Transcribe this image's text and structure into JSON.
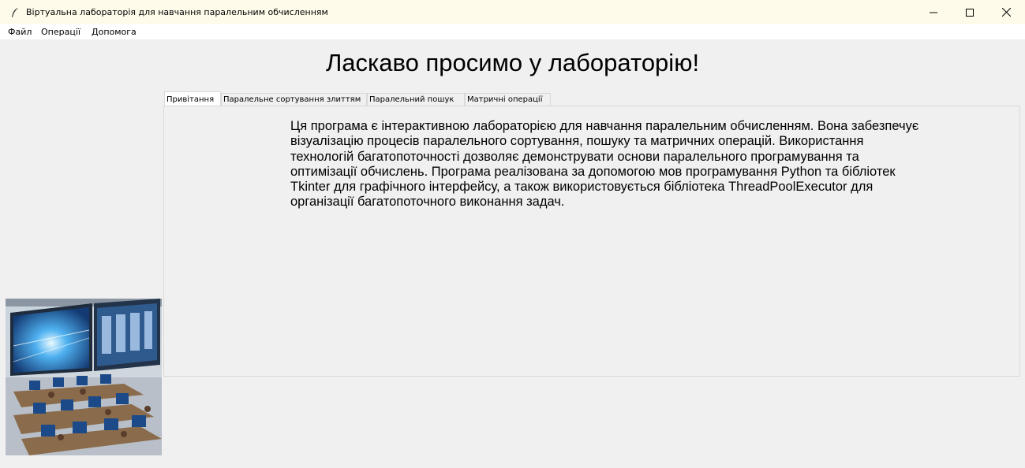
{
  "window": {
    "title": "Віртуальна лабораторія для навчання паралельним обчисленням",
    "icon": "feather-icon"
  },
  "menu": {
    "items": [
      "Файл",
      "Операції",
      "Допомога"
    ]
  },
  "heading": "Ласкаво просимо у лабораторію!",
  "tabs": [
    {
      "label": "Привітання",
      "active": true
    },
    {
      "label": "Паралельне сортування злиттям",
      "active": false
    },
    {
      "label": "Паралельний пошук",
      "active": false
    },
    {
      "label": "Матричні операції",
      "active": false
    }
  ],
  "welcome_text": "Ця програма є інтерактивною лабораторією для навчання паралельним обчисленням. Вона забезпечує візуалізацію процесів паралельного сортування, пошуку та матричних операцій. Використання технологій багатопоточності дозволяє демонструвати основи паралельного програмування та оптимізації обчислень. Програма реалізована за допомогою мов програмування Python та бібліотек Tkinter для графічного інтерфейсу, а також використовується бібліотека ThreadPoolExecutor для організації багатопоточного виконання задач."
}
